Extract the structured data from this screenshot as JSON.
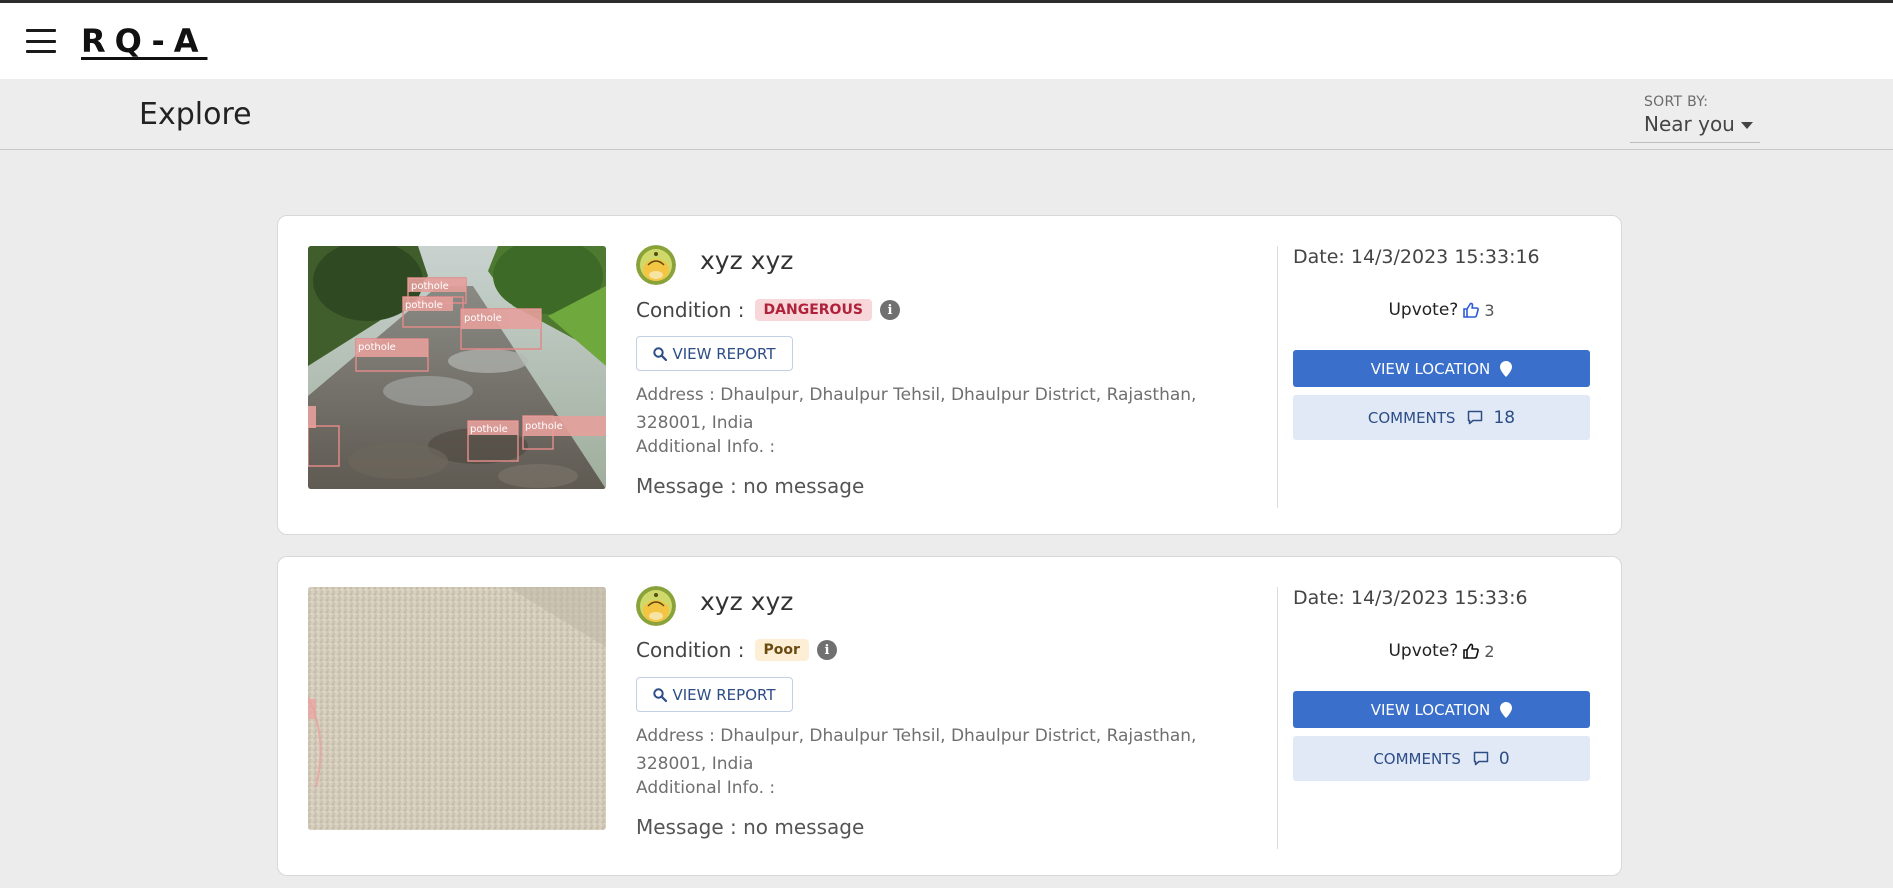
{
  "app": {
    "brand": "RQ-A"
  },
  "header": {
    "title": "Explore",
    "sort_label": "SORT BY:",
    "sort_value": "Near you"
  },
  "colors": {
    "primary": "#3a6fcc",
    "danger_badge_bg": "#f8d7da",
    "danger_badge_text": "#b0213b",
    "poor_badge_bg": "#fcefd6",
    "poor_badge_text": "#6b4a12",
    "page_bg": "#ececec"
  },
  "reports": [
    {
      "user_name": "xyz xyz",
      "condition_label": "Condition :",
      "condition": "DANGEROUS",
      "view_report_label": "VIEW REPORT",
      "address": "Address : Dhaulpur, Dhaulpur Tehsil, Dhaulpur District, Rajasthan, 328001, India",
      "additional_info": "Additional Info. :",
      "message": "Message : no message",
      "date": "Date: 14/3/2023 15:33:16",
      "upvote_label": "Upvote?",
      "upvotes": "3",
      "view_location_label": "VIEW LOCATION",
      "comments_label": "COMMENTS",
      "comments_count": "18",
      "detection_labels": [
        "pothole",
        "pothole",
        "pothole",
        "pothole",
        "pothole",
        "pothole"
      ],
      "icons": [
        "search-icon",
        "info-icon",
        "thumbs-up-icon",
        "map-pin-icon",
        "comment-icon"
      ]
    },
    {
      "user_name": "xyz xyz",
      "condition_label": "Condition :",
      "condition": "Poor",
      "view_report_label": "VIEW REPORT",
      "address": "Address : Dhaulpur, Dhaulpur Tehsil, Dhaulpur District, Rajasthan, 328001, India",
      "additional_info": "Additional Info. :",
      "message": "Message : no message",
      "date": "Date: 14/3/2023 15:33:6",
      "upvote_label": "Upvote?",
      "upvotes": "2",
      "view_location_label": "VIEW LOCATION",
      "comments_label": "COMMENTS",
      "comments_count": "0",
      "icons": [
        "search-icon",
        "info-icon",
        "thumbs-up-icon",
        "map-pin-icon",
        "comment-icon"
      ]
    }
  ]
}
